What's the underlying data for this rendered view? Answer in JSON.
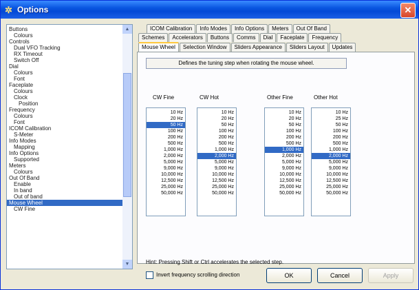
{
  "window": {
    "title": "Options",
    "close_glyph": "✕",
    "icon": "settings-icon"
  },
  "tree": {
    "items": [
      {
        "label": "Buttons",
        "indent": 0
      },
      {
        "label": "Colours",
        "indent": 1
      },
      {
        "label": "Controls",
        "indent": 0
      },
      {
        "label": "Dual VFO Tracking",
        "indent": 1
      },
      {
        "label": "RX Timeout",
        "indent": 1
      },
      {
        "label": "Switch Off",
        "indent": 1
      },
      {
        "label": "Dial",
        "indent": 0
      },
      {
        "label": "Colours",
        "indent": 1
      },
      {
        "label": "Font",
        "indent": 1
      },
      {
        "label": "Faceplate",
        "indent": 0
      },
      {
        "label": "Colours",
        "indent": 1
      },
      {
        "label": "Clock",
        "indent": 1
      },
      {
        "label": "Position",
        "indent": 2
      },
      {
        "label": "Frequency",
        "indent": 0
      },
      {
        "label": "Colours",
        "indent": 1
      },
      {
        "label": "Font",
        "indent": 1
      },
      {
        "label": "ICOM Calibration",
        "indent": 0
      },
      {
        "label": "S-Meter",
        "indent": 1
      },
      {
        "label": "Info Modes",
        "indent": 0
      },
      {
        "label": "Mapping",
        "indent": 1
      },
      {
        "label": "Info Options",
        "indent": 0
      },
      {
        "label": "Supported",
        "indent": 1
      },
      {
        "label": "Meters",
        "indent": 0
      },
      {
        "label": "Colours",
        "indent": 1
      },
      {
        "label": "Out Of Band",
        "indent": 0
      },
      {
        "label": "Enable",
        "indent": 1
      },
      {
        "label": "In band",
        "indent": 1
      },
      {
        "label": "Out of band",
        "indent": 1
      },
      {
        "label": "Mouse Wheel",
        "indent": 0,
        "selected": true
      },
      {
        "label": "CW Fine",
        "indent": 1
      }
    ]
  },
  "tabs": {
    "row1": [
      "ICOM Calibration",
      "Info Modes",
      "Info Options",
      "Meters",
      "Out Of Band"
    ],
    "row2": [
      "Schemes",
      "Accelerators",
      "Buttons",
      "Comms",
      "Dial",
      "Faceplate",
      "Frequency"
    ],
    "row3": [
      "Mouse Wheel",
      "Selection Window",
      "Sliders Appearance",
      "Sliders Layout",
      "Updates"
    ],
    "active": "Mouse Wheel"
  },
  "panel": {
    "description": "Defines the tuning step when rotating the mouse wheel.",
    "columns": [
      {
        "header": "CW Fine",
        "selected_index": 2
      },
      {
        "header": "CW Hot",
        "selected_index": 7
      },
      {
        "header": "Other Fine",
        "selected_index": 6
      },
      {
        "header": "Other Hot",
        "selected_index": 7
      }
    ],
    "steps_a": [
      "10 Hz",
      "20 Hz",
      "50 Hz",
      "100 Hz",
      "200 Hz",
      "500 Hz",
      "1,000 Hz",
      "2,000 Hz",
      "5,000 Hz",
      "9,000 Hz",
      "10,000 Hz",
      "12,500 Hz",
      "25,000 Hz",
      "50,000 Hz"
    ],
    "steps_b": [
      "10 Hz",
      "20 Hz",
      "50 Hz",
      "100 Hz",
      "200 Hz",
      "500 Hz",
      "1,000 Hz",
      "2,000 Hz",
      "5,000 Hz",
      "9,000 Hz",
      "10,000 Hz",
      "12,500 Hz",
      "25,000 Hz",
      "50,000 Hz"
    ],
    "steps_c": [
      "10 Hz",
      "20 Hz",
      "50 Hz",
      "100 Hz",
      "200 Hz",
      "500 Hz",
      "1,000 Hz",
      "2,000 Hz",
      "5,000 Hz",
      "9,000 Hz",
      "10,000 Hz",
      "12,500 Hz",
      "25,000 Hz",
      "50,000 Hz"
    ],
    "steps_d": [
      "10 Hz",
      "25 Hz",
      "50 Hz",
      "100 Hz",
      "200 Hz",
      "500 Hz",
      "1,000 Hz",
      "2,000 Hz",
      "5,000 Hz",
      "9,000 Hz",
      "10,000 Hz",
      "12,500 Hz",
      "25,000 Hz",
      "50,000 Hz"
    ],
    "hint": "Hint: Pressing Shift or Ctrl accelerates the selected step.",
    "invert_label": "Invert frequency scrolling direction",
    "invert_checked": false
  },
  "buttons": {
    "ok": "OK",
    "cancel": "Cancel",
    "apply": "Apply"
  }
}
